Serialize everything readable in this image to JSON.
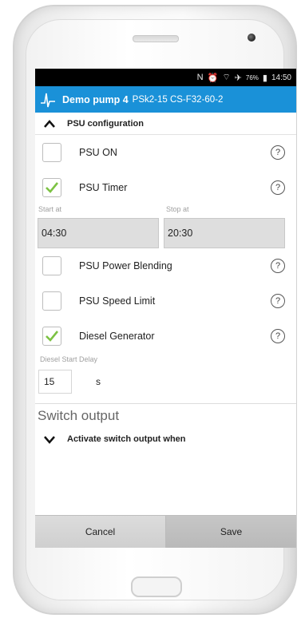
{
  "status_bar": {
    "battery": "76%",
    "time": "14:50"
  },
  "header": {
    "title": "Demo pump 4",
    "subtitle": "PSk2-15 CS-F32-60-2"
  },
  "psu_section": {
    "label": "PSU configuration"
  },
  "options": [
    {
      "label": "PSU ON",
      "checked": false
    },
    {
      "label": "PSU Timer",
      "checked": true
    },
    {
      "label": "PSU Power Blending",
      "checked": false
    },
    {
      "label": "PSU Speed Limit",
      "checked": false
    },
    {
      "label": "Diesel Generator",
      "checked": true
    }
  ],
  "help_symbol": "?",
  "timer": {
    "start_label": "Start at",
    "start_value": "04:30",
    "stop_label": "Stop at",
    "stop_value": "20:30"
  },
  "diesel": {
    "label": "Diesel Start Delay",
    "value": "15",
    "unit": "s"
  },
  "switch_output": {
    "title": "Switch output",
    "section_label": "Activate switch output when"
  },
  "buttons": {
    "cancel": "Cancel",
    "save": "Save"
  },
  "colors": {
    "accent": "#1a91d8",
    "check": "#7cc243"
  }
}
